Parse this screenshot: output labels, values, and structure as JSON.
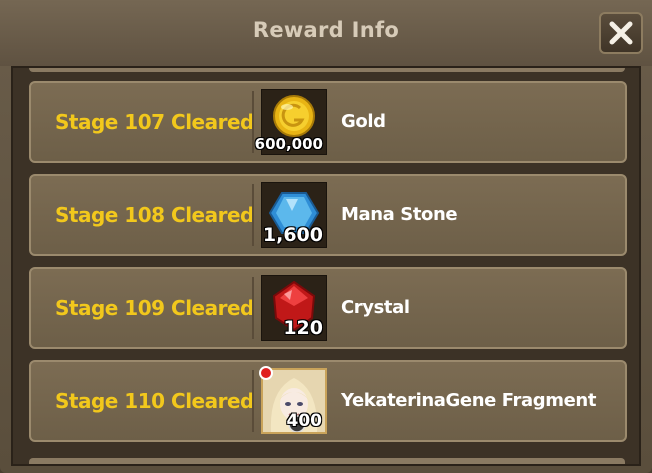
{
  "dialog": {
    "title": "Reward Info",
    "close_icon": "close-x-icon"
  },
  "rewards": [
    {
      "stage": "Stage 107 Cleared",
      "item": "Gold",
      "qty": "600,000",
      "icon": "gold-coin-icon"
    },
    {
      "stage": "Stage 108 Cleared",
      "item": "Mana Stone",
      "qty": "1,600",
      "icon": "mana-stone-icon"
    },
    {
      "stage": "Stage 109 Cleared",
      "item": "Crystal",
      "qty": "120",
      "icon": "crystal-icon"
    },
    {
      "stage": "Stage 110 Cleared",
      "item": "YekaterinaGene Fragment",
      "qty": "400",
      "icon": "character-portrait-icon"
    }
  ],
  "colors": {
    "stage_text": "#f2c81c",
    "panel": "#6d5f48",
    "frame": "#3c3226"
  }
}
